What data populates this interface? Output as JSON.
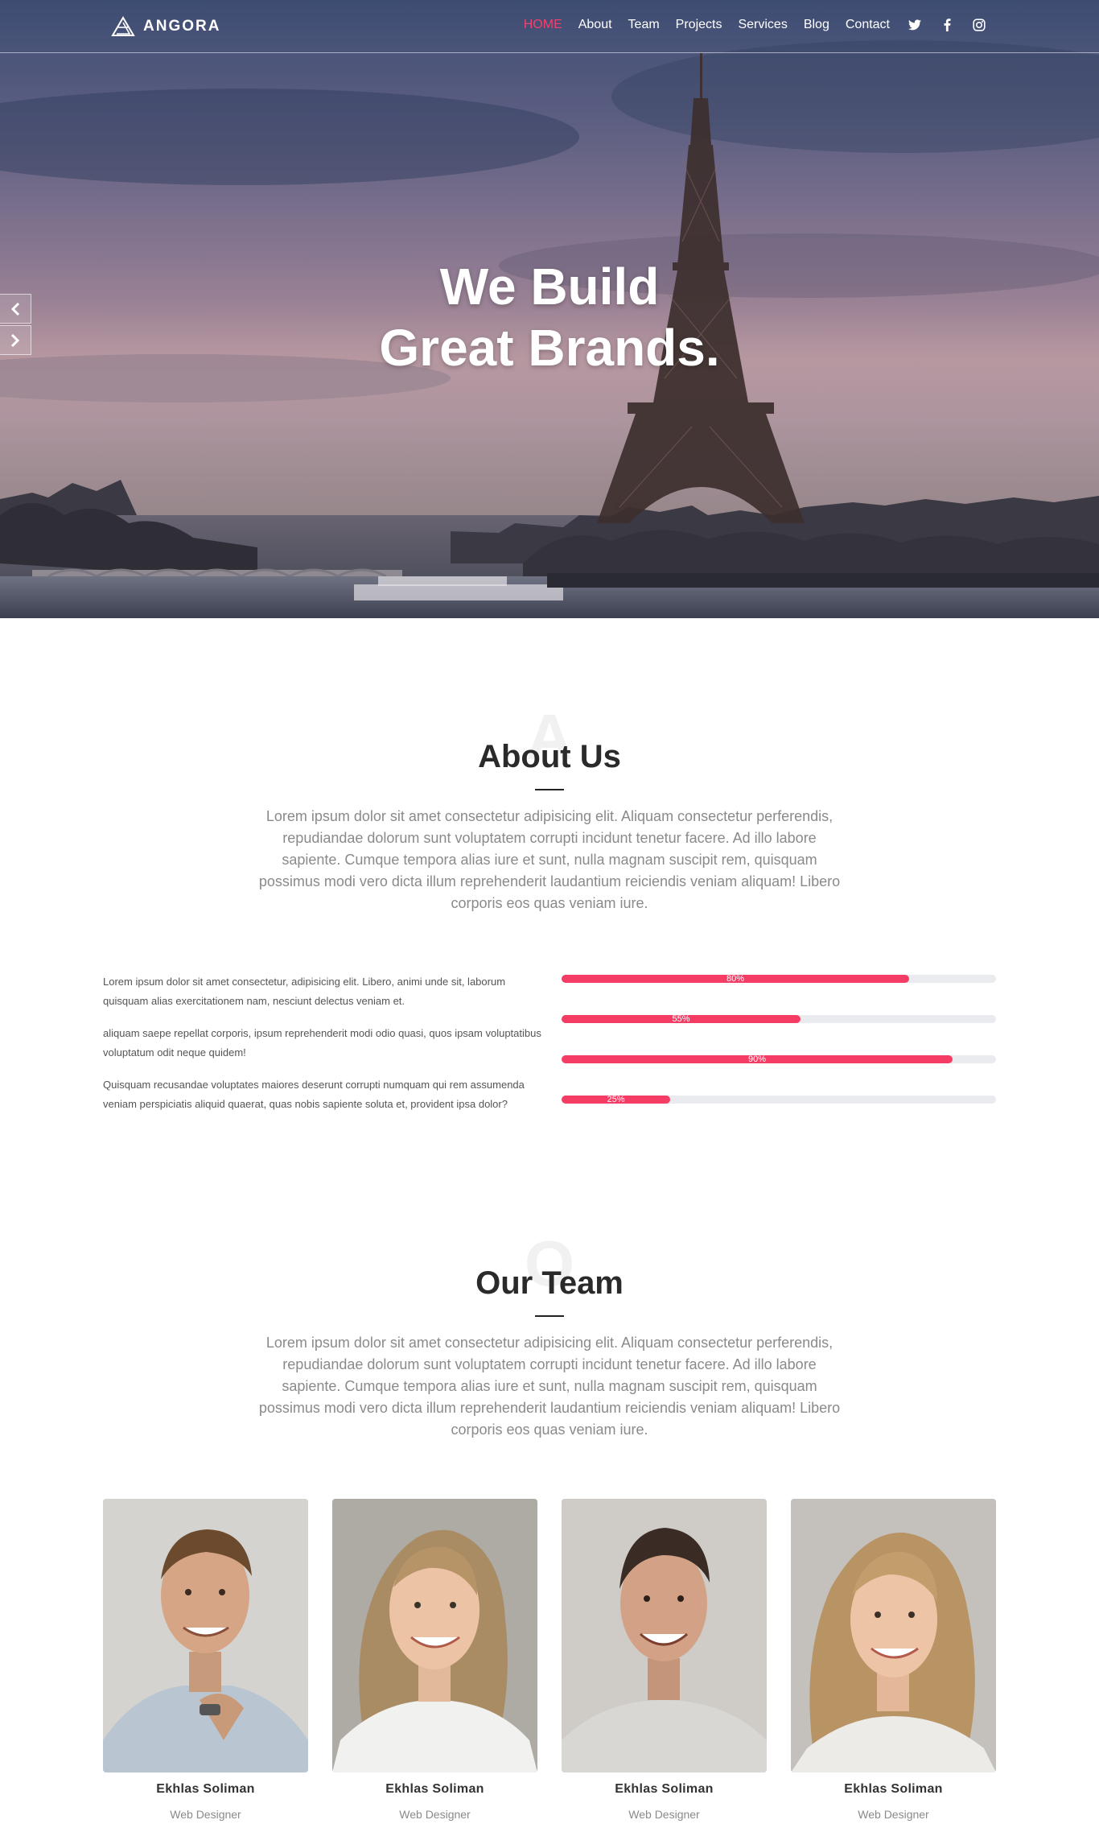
{
  "brand": {
    "name": "ANGORA"
  },
  "nav": {
    "links": [
      {
        "label": "HOME",
        "active": true
      },
      {
        "label": "About",
        "active": false
      },
      {
        "label": "Team",
        "active": false
      },
      {
        "label": "Projects",
        "active": false
      },
      {
        "label": "Services",
        "active": false
      },
      {
        "label": "Blog",
        "active": false
      },
      {
        "label": "Contact",
        "active": false
      }
    ],
    "social_icons": [
      "twitter-icon",
      "facebook-icon",
      "instagram-icon"
    ]
  },
  "hero": {
    "title_line1": "We Build",
    "title_line2": "Great Brands.",
    "prev_icon": "chevron-left-icon",
    "next_icon": "chevron-right-icon"
  },
  "about": {
    "ghost_letter": "A",
    "title": "About Us",
    "intro": "Lorem ipsum dolor sit amet consectetur adipisicing elit. Aliquam consectetur perferendis, repudiandae dolorum sunt voluptatem corrupti incidunt tenetur facere. Ad illo labore sapiente. Cumque tempora alias iure et sunt, nulla magnam suscipit rem, quisquam possimus modi vero dicta illum reprehenderit laudantium reiciendis veniam aliquam! Libero corporis eos quas veniam iure.",
    "paragraphs": [
      "Lorem ipsum dolor sit amet consectetur, adipisicing elit. Libero, animi unde sit, laborum quisquam alias exercitationem nam, nesciunt delectus veniam et.",
      "aliquam saepe repellat corporis, ipsum reprehenderit modi odio quasi, quos ipsam voluptatibus voluptatum odit neque quidem!",
      "Quisquam recusandae voluptates maiores deserunt corrupti numquam qui rem assumenda veniam perspiciatis aliquid quaerat, quas nobis sapiente soluta et, provident ipsa dolor?"
    ],
    "skills": [
      {
        "label": "80%",
        "value": 0.8
      },
      {
        "label": "55%",
        "value": 0.55
      },
      {
        "label": "90%",
        "value": 0.9
      },
      {
        "label": "25%",
        "value": 0.25
      }
    ]
  },
  "team": {
    "ghost_letter": "O",
    "title": "Our Team",
    "intro": "Lorem ipsum dolor sit amet consectetur adipisicing elit. Aliquam consectetur perferendis, repudiandae dolorum sunt voluptatem corrupti incidunt tenetur facere. Ad illo labore sapiente. Cumque tempora alias iure et sunt, nulla magnam suscipit rem, quisquam possimus modi vero dicta illum reprehenderit laudantium reiciendis veniam aliquam! Libero corporis eos quas veniam iure.",
    "members": [
      {
        "name": "Ekhlas Soliman",
        "role": "Web Designer"
      },
      {
        "name": "Ekhlas Soliman",
        "role": "Web Designer"
      },
      {
        "name": "Ekhlas Soliman",
        "role": "Web Designer"
      },
      {
        "name": "Ekhlas Soliman",
        "role": "Web Designer"
      }
    ]
  },
  "colors": {
    "accent": "#f53c64",
    "nav_active": "#f0416f",
    "bar_track": "#e9ebef"
  }
}
